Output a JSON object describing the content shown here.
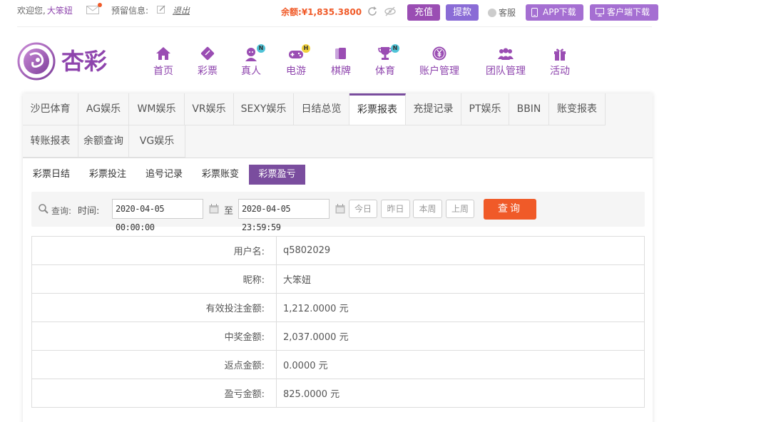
{
  "topbar": {
    "welcome": "欢迎您,",
    "username": "大笨妞",
    "notice_label": "预留信息:",
    "logout": "退出",
    "balance_label": "余额:",
    "balance_value": "¥1,835.3800",
    "recharge": "充值",
    "withdraw": "提款",
    "service": "客服",
    "app_download": "APP下载",
    "client_download": "客户端下载"
  },
  "logo": {
    "text": "杏彩"
  },
  "nav": [
    {
      "label": "首页",
      "icon": "home-icon"
    },
    {
      "label": "彩票",
      "icon": "ticket-icon"
    },
    {
      "label": "真人",
      "icon": "dealer-icon",
      "badge": "N"
    },
    {
      "label": "电游",
      "icon": "gamepad-icon",
      "badge": "H"
    },
    {
      "label": "棋牌",
      "icon": "cards-icon"
    },
    {
      "label": "体育",
      "icon": "trophy-icon",
      "badge": "N"
    },
    {
      "label": "账户管理",
      "icon": "yen-coin-icon"
    },
    {
      "label": "团队管理",
      "icon": "team-icon"
    },
    {
      "label": "活动",
      "icon": "gift-icon"
    }
  ],
  "tabs": [
    "沙巴体育",
    "AG娱乐",
    "WM娱乐",
    "VR娱乐",
    "SEXY娱乐",
    "日结总览",
    "彩票报表",
    "充提记录",
    "PT娱乐",
    "BBIN",
    "账变报表",
    "转账报表",
    "余额查询",
    "VG娱乐"
  ],
  "active_tab": "彩票报表",
  "subtabs": [
    "彩票日结",
    "彩票投注",
    "追号记录",
    "彩票账变",
    "彩票盈亏"
  ],
  "active_subtab": "彩票盈亏",
  "query": {
    "query_label": "查询:",
    "time_label": "时间:",
    "start": "2020-04-05 00:00:00",
    "to": "至",
    "end": "2020-04-05 23:59:59",
    "quick": [
      "今日",
      "昨日",
      "本周",
      "上周"
    ],
    "search": "查询"
  },
  "rows": [
    {
      "label": "用户名:",
      "value": "q5802029"
    },
    {
      "label": "昵称:",
      "value": "大笨妞"
    },
    {
      "label": "有效投注金额:",
      "value": "1,212.0000 元"
    },
    {
      "label": "中奖金额:",
      "value": "2,037.0000 元"
    },
    {
      "label": "返点金额:",
      "value": "0.0000 元"
    },
    {
      "label": "盈亏金额:",
      "value": "825.0000 元"
    }
  ],
  "colors": {
    "brand": "#8e44ad",
    "active": "#7a4d9e",
    "accent": "#f05a28"
  }
}
